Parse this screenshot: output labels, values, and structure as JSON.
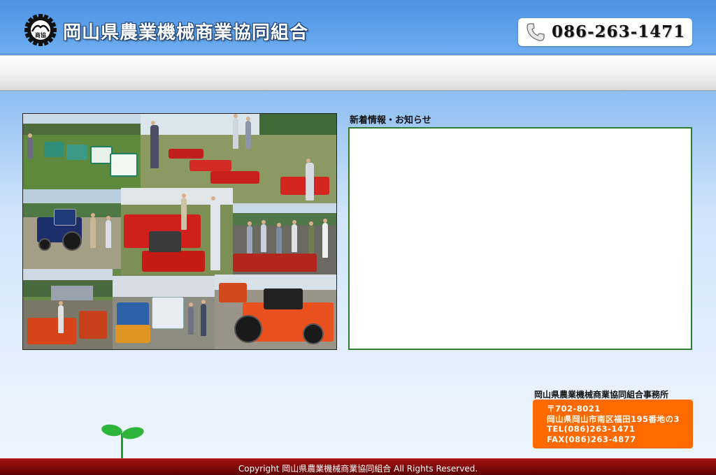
{
  "header": {
    "logo_text": "商協",
    "org_name": "岡山県農業機械商業協同組合",
    "phone": "086-263-1471"
  },
  "colors": {
    "header_blue": "#5ca0ea",
    "news_border": "#2e7d32",
    "office_orange": "#ff6a00",
    "footer_red": "#7a0808"
  },
  "news": {
    "heading": "新着情報・お知らせ"
  },
  "office": {
    "heading": "岡山県農業機械商業協同組合事務所",
    "postal": "〒702-8021",
    "address": "岡山県岡山市南区福田195番地の3",
    "tel": "TEL(086)263-1471",
    "fax": "FAX(086)263-4877"
  },
  "footer": {
    "copyright": "Copyright 岡山県農業機械商業協同組合 All Rights Reserved."
  },
  "icons": [
    "gear-logo-icon",
    "phone-icon",
    "sprout-icon"
  ]
}
